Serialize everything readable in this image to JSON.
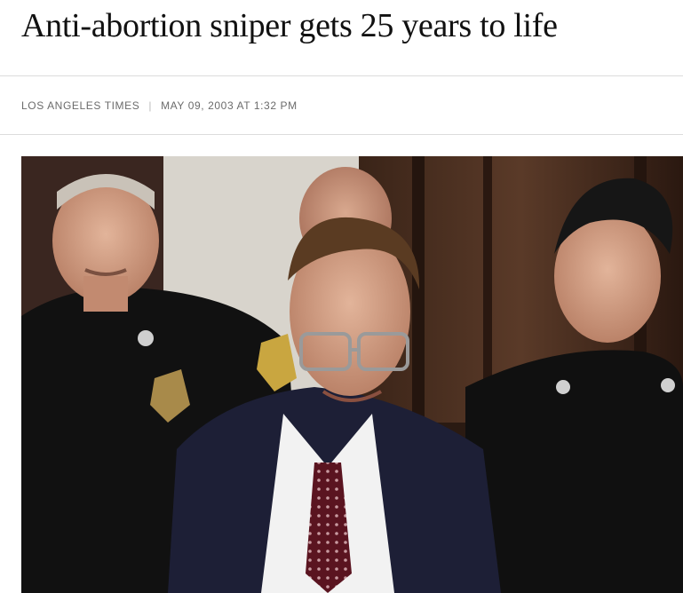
{
  "article": {
    "headline": "Anti-abortion sniper gets 25 years to life",
    "source": "LOS ANGELES TIMES",
    "separator": "|",
    "dateline": "MAY 09, 2003 AT 1:32 PM"
  },
  "photo": {
    "subject": "man in suit and tie escorted by two uniformed officers"
  }
}
